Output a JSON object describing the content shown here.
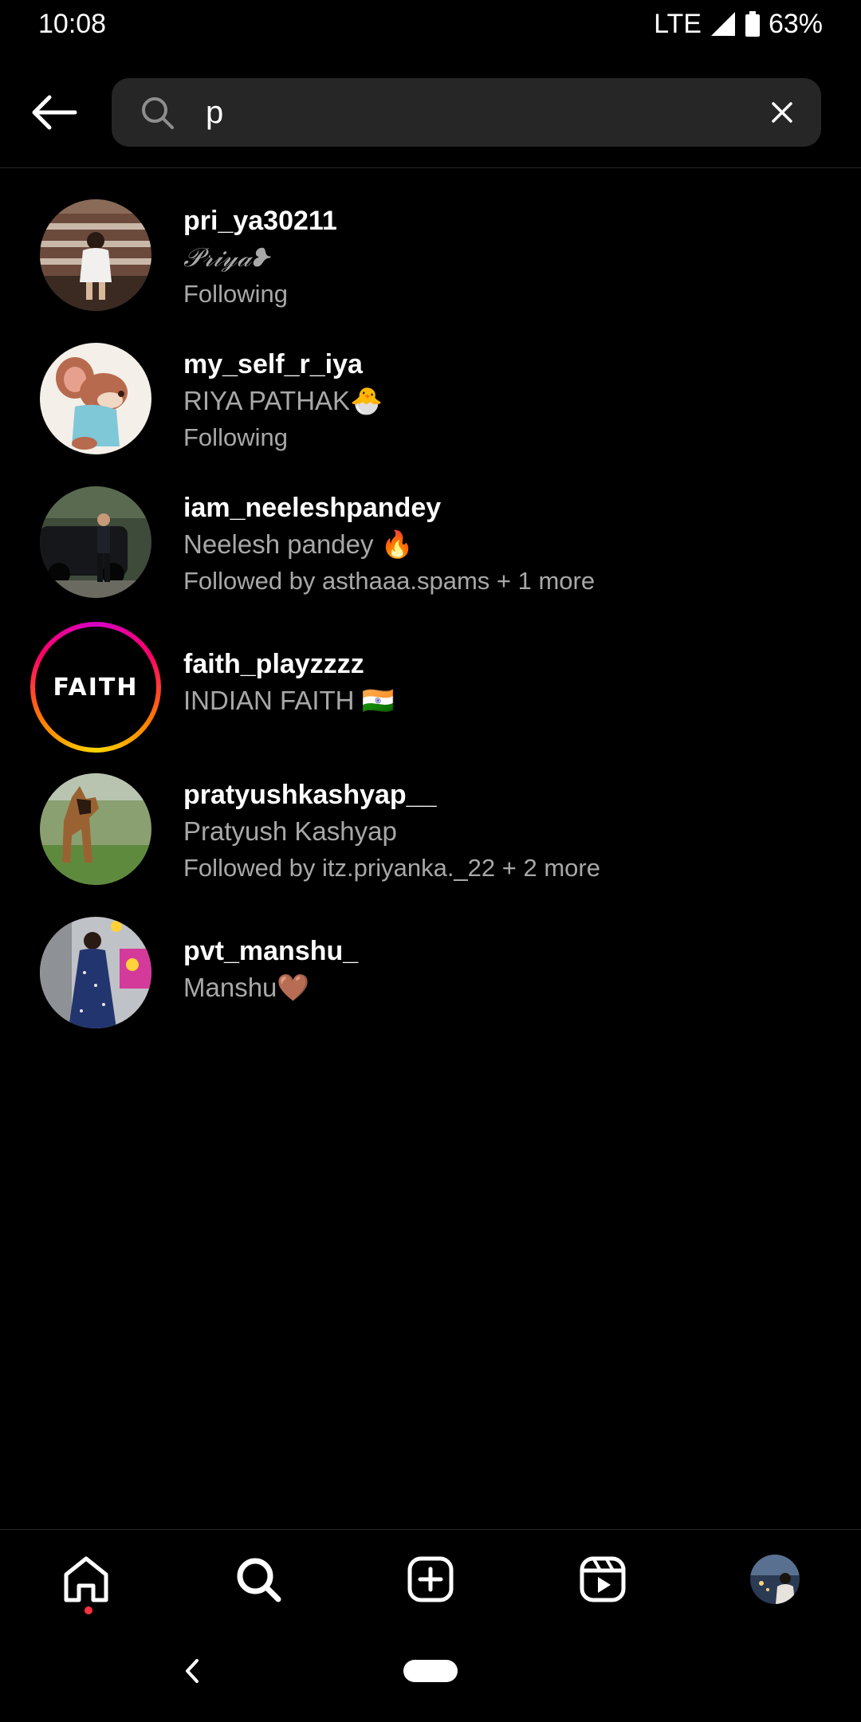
{
  "status_bar": {
    "time": "10:08",
    "network": "LTE",
    "battery": "63%"
  },
  "search": {
    "query": "p"
  },
  "results": [
    {
      "username": "pri_ya30211",
      "fullname": "𝒫𝓇𝒾𝓎𝒶❥",
      "subline": "Following"
    },
    {
      "username": "my_self_r_iya",
      "fullname": "RIYA PATHAK🐣",
      "subline": "Following"
    },
    {
      "username": "iam_neeleshpandey",
      "fullname": "Neelesh pandey 🔥",
      "subline": "Followed by asthaaa.spams + 1 more"
    },
    {
      "username": "faith_playzzzz",
      "fullname": "INDIAN FAITH 🇮🇳",
      "avatar_text": "FAITH"
    },
    {
      "username": "pratyushkashyap__",
      "fullname": "Pratyush Kashyap",
      "subline": "Followed by itz.priyanka._22 + 2 more"
    },
    {
      "username": "pvt_manshu_",
      "fullname": "Manshu🤎"
    }
  ],
  "bottom_nav": {
    "items": [
      "home-icon",
      "search-icon",
      "create-icon",
      "reels-icon",
      "profile-avatar"
    ],
    "active": "search-icon",
    "notification_dot_color": "#ff3040"
  },
  "colors": {
    "background": "#000000",
    "search_box": "#262626",
    "secondary_text": "#a8a8a8"
  }
}
